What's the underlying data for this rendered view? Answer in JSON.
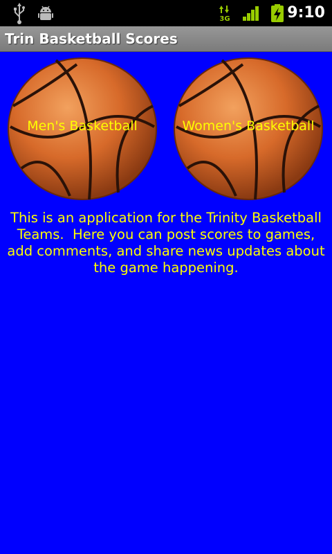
{
  "status_bar": {
    "time": "9:10",
    "icons": [
      "usb-icon",
      "android-debug-icon",
      "3g-data-icon",
      "signal-icon",
      "battery-charging-icon"
    ],
    "accent_color": "#99cc00"
  },
  "title_bar": {
    "title": "Trin Basketball Scores"
  },
  "buttons": {
    "men_label": "Men's Basketball",
    "women_label": "Women's Basketball"
  },
  "description": "This is an application for the Trinity Basketball Teams.  Here you can post scores to games, add comments, and share news updates about the game happening.",
  "colors": {
    "background": "#0000ff",
    "text": "#ffff00",
    "ball": "#d2691e"
  }
}
